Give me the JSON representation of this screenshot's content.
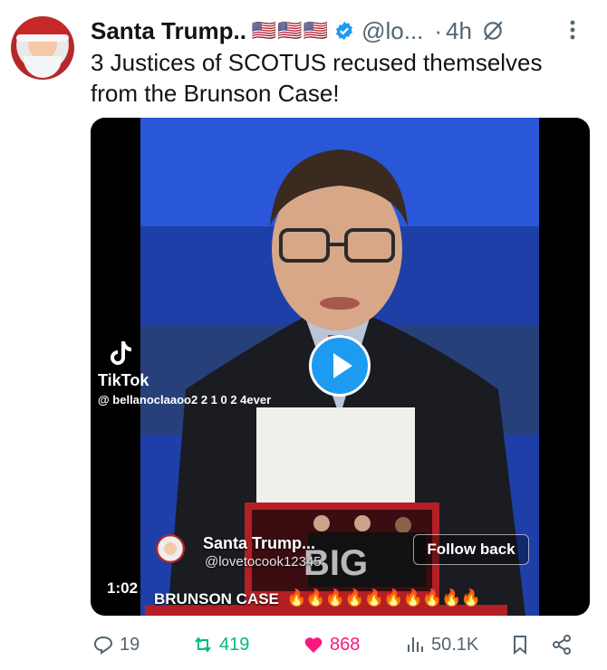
{
  "post": {
    "display_name": "Santa Trump..",
    "flags": "🇺🇸🇺🇸🇺🇸",
    "handle": "@lo...",
    "time_separator": "·",
    "time": "4h",
    "text": "3 Justices of SCOTUS recused themselves from the Brunson Case!"
  },
  "video": {
    "tiktok_label": "TikTok",
    "tiktok_user": "@ bellanoclaaoo2 2 1 0 2 4ever",
    "overlay_name": "Santa Trump...",
    "overlay_handle": "@lovetocook12345",
    "follow_label": "Follow back",
    "duration": "1:02",
    "caption": "BRUNSON CASE",
    "flames": "🔥🔥🔥🔥🔥🔥🔥🔥🔥🔥"
  },
  "actions": {
    "replies": "19",
    "reposts": "419",
    "likes": "868",
    "views": "50.1K"
  },
  "colors": {
    "verified": "#1d9bf0",
    "repost": "#00ba7c",
    "like": "#f91880",
    "muted": "#536471"
  },
  "icons": [
    "verified-badge-icon",
    "grok-icon",
    "more-icon",
    "tiktok-icon",
    "play-icon",
    "reply-icon",
    "repost-icon",
    "heart-icon",
    "views-icon",
    "bookmark-icon",
    "share-icon"
  ]
}
